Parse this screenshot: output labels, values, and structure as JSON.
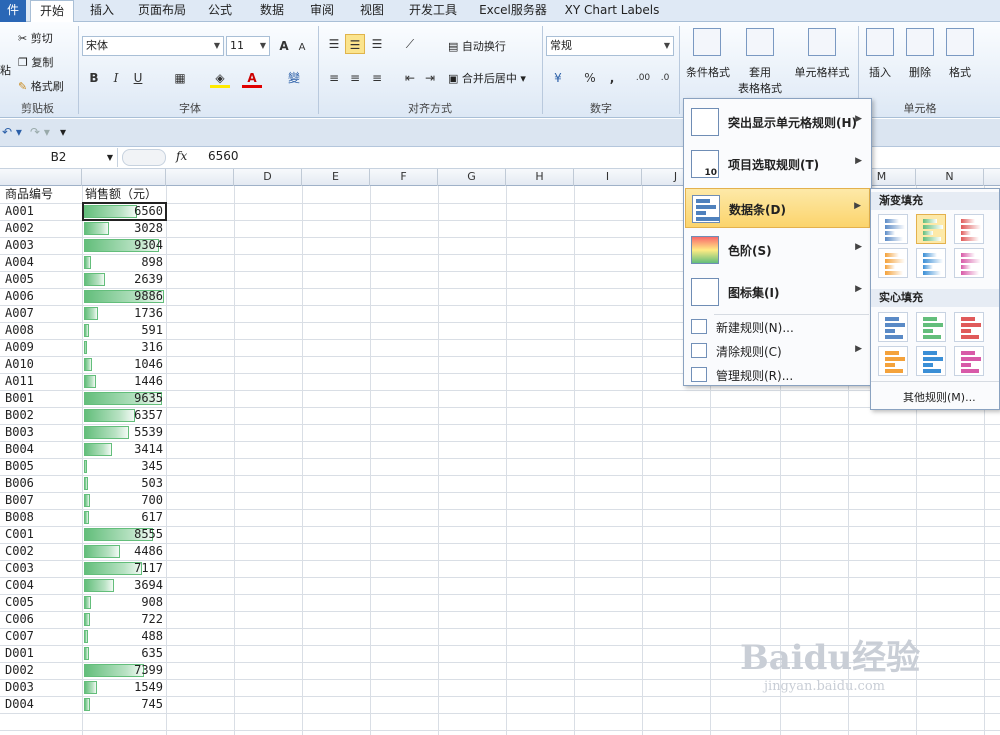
{
  "tabs": [
    {
      "label": "件",
      "kind": "file"
    },
    {
      "label": "开始",
      "kind": "active"
    },
    {
      "label": "插入"
    },
    {
      "label": "页面布局"
    },
    {
      "label": "公式"
    },
    {
      "label": "数据"
    },
    {
      "label": "审阅"
    },
    {
      "label": "视图"
    },
    {
      "label": "开发工具"
    },
    {
      "label": "Excel服务器"
    },
    {
      "label": "XY Chart Labels"
    }
  ],
  "ribbon": {
    "clipboard": {
      "cut": "剪切",
      "copy": "复制",
      "format_painter": "格式刷",
      "paste": "粘",
      "group": "剪贴板"
    },
    "font": {
      "name": "宋体",
      "size": "11",
      "bold": "B",
      "italic": "I",
      "underline": "U",
      "group": "字体",
      "grow": "A",
      "shrink": "A",
      "phonetic": "變"
    },
    "alignment": {
      "wrap": "自动换行",
      "merge": "合并后居中",
      "group": "对齐方式"
    },
    "number": {
      "format": "常规",
      "percent": "%",
      "comma": ",",
      "inc": ".00",
      "dec": ".0",
      "group": "数字"
    },
    "styles": {
      "conditional": "条件格式",
      "table_line1": "套用",
      "table_line2": "表格格式",
      "cell_styles": "单元格样式"
    },
    "cells": {
      "insert": "插入",
      "delete": "删除",
      "format": "格式",
      "group": "单元格"
    }
  },
  "formula_bar": {
    "name_box": "B2",
    "fx": "fx",
    "value": "6560"
  },
  "columns": [
    "D",
    "E",
    "F",
    "G",
    "H",
    "I",
    "J",
    "M",
    "N"
  ],
  "sheet": {
    "header_a": "商品编号",
    "header_b": "销售额（元）",
    "max_value": 9886,
    "rows": [
      {
        "id": "A001",
        "value": 6560
      },
      {
        "id": "A002",
        "value": 3028
      },
      {
        "id": "A003",
        "value": 9304
      },
      {
        "id": "A004",
        "value": 898
      },
      {
        "id": "A005",
        "value": 2639
      },
      {
        "id": "A006",
        "value": 9886
      },
      {
        "id": "A007",
        "value": 1736
      },
      {
        "id": "A008",
        "value": 591
      },
      {
        "id": "A009",
        "value": 316
      },
      {
        "id": "A010",
        "value": 1046
      },
      {
        "id": "A011",
        "value": 1446
      },
      {
        "id": "B001",
        "value": 9635
      },
      {
        "id": "B002",
        "value": 6357
      },
      {
        "id": "B003",
        "value": 5539
      },
      {
        "id": "B004",
        "value": 3414
      },
      {
        "id": "B005",
        "value": 345
      },
      {
        "id": "B006",
        "value": 503
      },
      {
        "id": "B007",
        "value": 700
      },
      {
        "id": "B008",
        "value": 617
      },
      {
        "id": "C001",
        "value": 8555
      },
      {
        "id": "C002",
        "value": 4486
      },
      {
        "id": "C003",
        "value": 7117
      },
      {
        "id": "C004",
        "value": 3694
      },
      {
        "id": "C005",
        "value": 908
      },
      {
        "id": "C006",
        "value": 722
      },
      {
        "id": "C007",
        "value": 488
      },
      {
        "id": "D001",
        "value": 635
      },
      {
        "id": "D002",
        "value": 7399
      },
      {
        "id": "D003",
        "value": 1549
      },
      {
        "id": "D004",
        "value": 745
      }
    ]
  },
  "cf_menu": {
    "big_items": [
      {
        "label": "突出显示单元格规则(H)"
      },
      {
        "label": "项目选取规则(T)"
      },
      {
        "label": "数据条(D)",
        "highlighted": true
      },
      {
        "label": "色阶(S)"
      },
      {
        "label": "图标集(I)"
      }
    ],
    "small_items": [
      {
        "label": "新建规则(N)..."
      },
      {
        "label": "清除规则(C)"
      },
      {
        "label": "管理规则(R)..."
      }
    ]
  },
  "databar_submenu": {
    "gradient_title": "渐变填充",
    "solid_title": "实心填充",
    "more": "其他规则(M)...",
    "colors": [
      "#5a8ac6",
      "#63be7b",
      "#e05a5a",
      "#f4a23b",
      "#3b8fd6",
      "#d85aa8"
    ],
    "selected_color": "#63be7b"
  },
  "watermark": {
    "brand": "Baidu经验",
    "site": "jingyan.baidu.com"
  }
}
